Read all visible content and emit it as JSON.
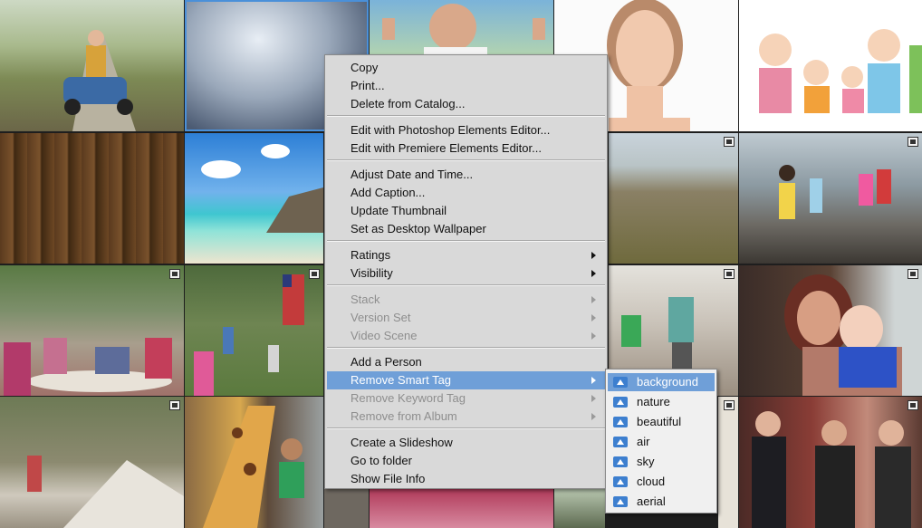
{
  "context_menu": {
    "items": [
      {
        "label": "Copy",
        "enabled": true,
        "submenu": false
      },
      {
        "label": "Print...",
        "enabled": true,
        "submenu": false
      },
      {
        "label": "Delete from Catalog...",
        "enabled": true,
        "submenu": false
      },
      {
        "label": "Edit with Photoshop Elements Editor...",
        "enabled": true,
        "submenu": false
      },
      {
        "label": "Edit with Premiere Elements Editor...",
        "enabled": true,
        "submenu": false
      },
      {
        "label": "Adjust Date and Time...",
        "enabled": true,
        "submenu": false
      },
      {
        "label": "Add Caption...",
        "enabled": true,
        "submenu": false
      },
      {
        "label": "Update Thumbnail",
        "enabled": true,
        "submenu": false
      },
      {
        "label": "Set as Desktop Wallpaper",
        "enabled": true,
        "submenu": false
      },
      {
        "label": "Ratings",
        "enabled": true,
        "submenu": true
      },
      {
        "label": "Visibility",
        "enabled": true,
        "submenu": true
      },
      {
        "label": "Stack",
        "enabled": false,
        "submenu": true
      },
      {
        "label": "Version Set",
        "enabled": false,
        "submenu": true
      },
      {
        "label": "Video Scene",
        "enabled": false,
        "submenu": true
      },
      {
        "label": "Add a Person",
        "enabled": true,
        "submenu": false
      },
      {
        "label": "Remove Smart Tag",
        "enabled": true,
        "submenu": true,
        "highlighted": true
      },
      {
        "label": "Remove Keyword Tag",
        "enabled": false,
        "submenu": true
      },
      {
        "label": "Remove from Album",
        "enabled": false,
        "submenu": true
      },
      {
        "label": "Create a Slideshow",
        "enabled": true,
        "submenu": false
      },
      {
        "label": "Go to folder",
        "enabled": true,
        "submenu": false
      },
      {
        "label": "Show File Info",
        "enabled": true,
        "submenu": false
      }
    ]
  },
  "smart_tag_submenu": {
    "items": [
      {
        "label": "background",
        "highlighted": true
      },
      {
        "label": "nature"
      },
      {
        "label": "beautiful"
      },
      {
        "label": "air"
      },
      {
        "label": "sky"
      },
      {
        "label": "cloud"
      },
      {
        "label": "aerial"
      }
    ],
    "icon": "smart-tag-icon"
  },
  "thumbnails": [
    {
      "subject": "child on toy car on country road",
      "video": false,
      "selected": false
    },
    {
      "subject": "clouds",
      "video": false,
      "selected": true
    },
    {
      "subject": "smiling woman thumbs up",
      "video": false,
      "selected": false
    },
    {
      "subject": "woman face portrait",
      "video": false,
      "selected": false
    },
    {
      "subject": "cartoon family",
      "video": false,
      "selected": false
    },
    {
      "subject": "wooden planks",
      "video": false,
      "selected": false
    },
    {
      "subject": "tropical beach",
      "video": false,
      "selected": false
    },
    {
      "subject": "sand dunes grass",
      "video": true,
      "selected": false
    },
    {
      "subject": "kids on beach",
      "video": true,
      "selected": false
    },
    {
      "subject": "women at garden table",
      "video": true,
      "selected": false
    },
    {
      "subject": "children in backyard with flag",
      "video": true,
      "selected": false
    },
    {
      "subject": "mother and girl in surf",
      "video": true,
      "selected": false
    },
    {
      "subject": "woman holding baby",
      "video": true,
      "selected": false
    },
    {
      "subject": "girl in woods",
      "video": true,
      "selected": false
    },
    {
      "subject": "boy on carousel giraffe",
      "video": false,
      "selected": false
    },
    {
      "subject": "people toasting",
      "video": true,
      "selected": false
    }
  ],
  "colors": {
    "menu_bg": "#d9d9d9",
    "highlight": "#6f9fd8",
    "submenu_bg": "#f0f0f0"
  }
}
